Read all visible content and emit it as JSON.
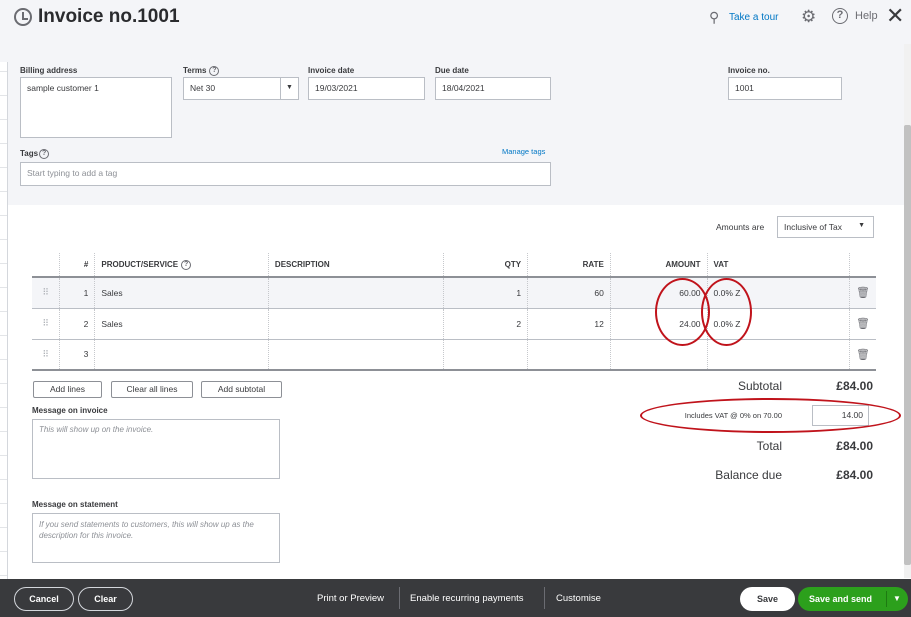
{
  "header": {
    "title": "Invoice no.1001",
    "take_tour": "Take a tour",
    "help": "Help"
  },
  "form": {
    "billing_address_label": "Billing address",
    "billing_address_value": "sample customer 1",
    "terms_label": "Terms",
    "terms_value": "Net 30",
    "invoice_date_label": "Invoice date",
    "invoice_date_value": "19/03/2021",
    "due_date_label": "Due date",
    "due_date_value": "18/04/2021",
    "invoice_no_label": "Invoice no.",
    "invoice_no_value": "1001",
    "tags_label": "Tags",
    "manage_tags": "Manage tags",
    "tags_placeholder": "Start typing to add a tag"
  },
  "amounts": {
    "label": "Amounts are",
    "value": "Inclusive of Tax"
  },
  "table": {
    "headers": {
      "num": "#",
      "product": "PRODUCT/SERVICE",
      "description": "DESCRIPTION",
      "qty": "QTY",
      "rate": "RATE",
      "amount": "AMOUNT",
      "vat": "VAT"
    },
    "rows": [
      {
        "num": "1",
        "product": "Sales",
        "description": "",
        "qty": "1",
        "rate": "60",
        "amount": "60.00",
        "vat": "0.0% Z"
      },
      {
        "num": "2",
        "product": "Sales",
        "description": "",
        "qty": "2",
        "rate": "12",
        "amount": "24.00",
        "vat": "0.0% Z"
      },
      {
        "num": "3",
        "product": "",
        "description": "",
        "qty": "",
        "rate": "",
        "amount": "",
        "vat": ""
      }
    ]
  },
  "table_actions": {
    "add_lines": "Add lines",
    "clear_all_lines": "Clear all lines",
    "add_subtotal": "Add subtotal"
  },
  "messages": {
    "invoice_label": "Message on invoice",
    "invoice_placeholder": "This will show up on the invoice.",
    "statement_label": "Message on statement",
    "statement_placeholder": "If you send statements to customers, this will show up as the description for this invoice."
  },
  "totals": {
    "subtotal_label": "Subtotal",
    "subtotal_value": "£84.00",
    "vat_label": "Includes VAT @ 0% on 70.00",
    "vat_value": "14.00",
    "total_label": "Total",
    "total_value": "£84.00",
    "balance_label": "Balance due",
    "balance_value": "£84.00"
  },
  "footer": {
    "cancel": "Cancel",
    "clear": "Clear",
    "print_preview": "Print or Preview",
    "recurring": "Enable recurring payments",
    "customise": "Customise",
    "save": "Save",
    "save_and_send": "Save and send"
  },
  "colors": {
    "brand_green": "#2ca01c",
    "link_blue": "#0077c5",
    "annotation_red": "#c0131b",
    "footer_bg": "#393a3d"
  }
}
